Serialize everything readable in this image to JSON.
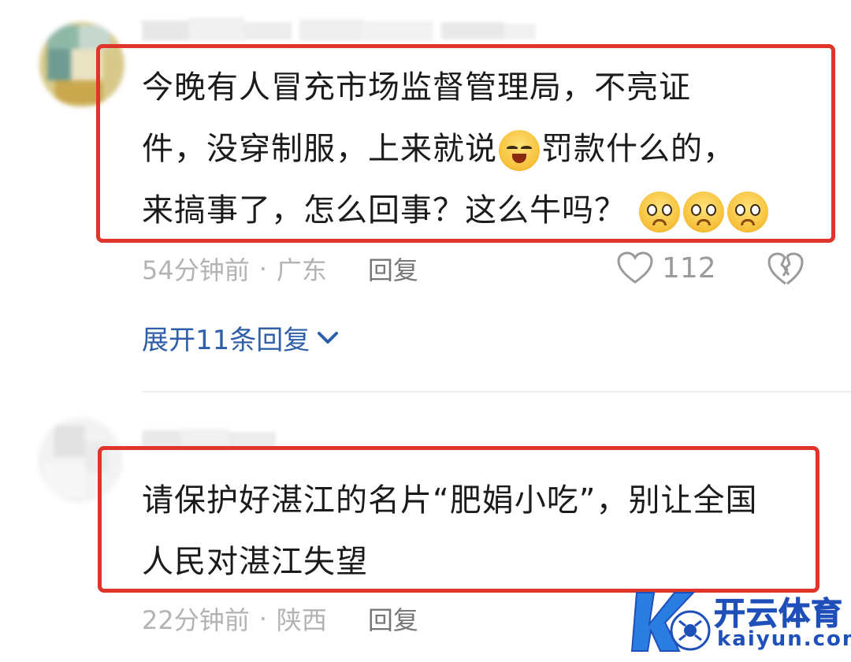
{
  "comments": [
    {
      "text_lines": [
        "今晚有人冒充市场监督管理局，不亮证",
        "件，没穿制服，上来就说",
        "罚款什么的，",
        "来搞事了，怎么回事？这么牛吗？"
      ],
      "time": "54分钟前",
      "separator": "·",
      "location": "广东",
      "reply_label": "回复",
      "like_count": "112",
      "expand_label": "展开11条回复"
    },
    {
      "text_lines": [
        "请保护好湛江的名片“肥娟小吃”，别让全国",
        "人民对湛江失望"
      ],
      "time": "22分钟前",
      "separator": "·",
      "location": "陕西",
      "reply_label": "回复"
    }
  ],
  "watermark": {
    "brand_cn": "开云体育",
    "brand_en": "kaiyun.com"
  },
  "icons": {
    "like": "heart-icon",
    "dislike": "broken-heart-icon",
    "expand": "chevron-down-icon",
    "emoji_laugh": "laughing-emoji-icon",
    "emoji_pleading": "pleading-emoji-icon"
  },
  "colors": {
    "highlight": "#e0352b",
    "link": "#2e5fa8",
    "meta": "#b3b3b3",
    "watermark": "#1f4fb8"
  }
}
